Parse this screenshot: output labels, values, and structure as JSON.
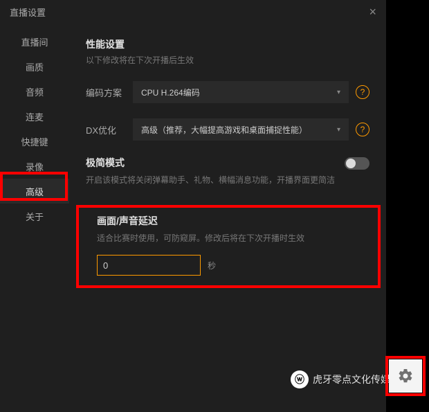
{
  "window": {
    "title": "直播设置"
  },
  "sidebar": {
    "items": [
      {
        "label": "直播间"
      },
      {
        "label": "画质"
      },
      {
        "label": "音频"
      },
      {
        "label": "连麦"
      },
      {
        "label": "快捷键"
      },
      {
        "label": "录像"
      },
      {
        "label": "高级"
      },
      {
        "label": "关于"
      }
    ],
    "active_index": 6
  },
  "perf": {
    "title": "性能设置",
    "subtitle": "以下修改将在下次开播后生效",
    "encoder_label": "编码方案",
    "encoder_value": "CPU H.264编码",
    "dx_label": "DX优化",
    "dx_value": "高级（推荐，大幅提高游戏和桌面捕捉性能）"
  },
  "simple_mode": {
    "title": "极简模式",
    "desc": "开启该模式将关闭弹幕助手、礼物、横幅消息功能，开播界面更简洁",
    "enabled": false
  },
  "delay": {
    "title": "画面/声音延迟",
    "desc": "适合比赛时使用，可防窥屏。修改后将在下次开播时生效",
    "value": "0",
    "unit": "秒"
  },
  "watermark": {
    "text": "虎牙零点文化传媒"
  }
}
